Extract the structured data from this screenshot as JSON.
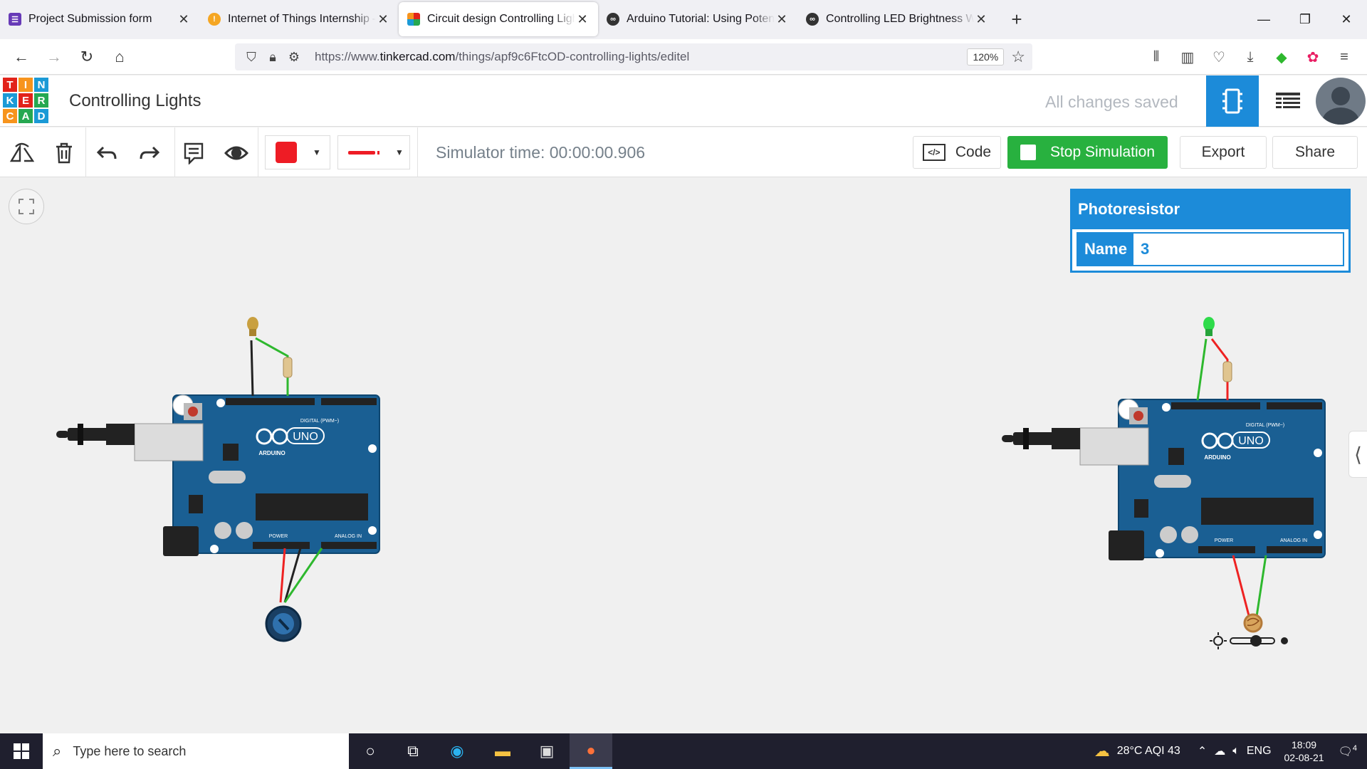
{
  "browser": {
    "tabs": [
      {
        "title": "Project Submission form",
        "fav_color": "#673ab7",
        "fav_glyph": "☰"
      },
      {
        "title": "Internet of Things Internship – ",
        "fav_color": "#f5a623",
        "fav_glyph": "!"
      },
      {
        "title": "Circuit design Controlling Lights",
        "fav_color": "#e53935",
        "fav_glyph": "▦"
      },
      {
        "title": "Arduino Tutorial: Using Potentio",
        "fav_color": "#333333",
        "fav_glyph": "∞"
      },
      {
        "title": "Controlling LED Brightness With",
        "fav_color": "#333333",
        "fav_glyph": "∞"
      }
    ],
    "url_prefix": "https://www.",
    "url_domain": "tinkercad.com",
    "url_path": "/things/apf9c6FtcOD-controlling-lights/editel",
    "zoom": "120%"
  },
  "app": {
    "logo_letters": [
      "T",
      "I",
      "N",
      "K",
      "E",
      "R",
      "C",
      "A",
      "D"
    ],
    "logo_colors": [
      "#e2231a",
      "#f7941d",
      "#1b9ad6",
      "#1b9ad6",
      "#e2231a",
      "#26a851",
      "#f7941d",
      "#26a851",
      "#1b9ad6"
    ],
    "title": "Controlling Lights",
    "save_status": "All changes saved"
  },
  "toolbar": {
    "sim_time": "Simulator time: 00:00:00.906",
    "code_label": "Code",
    "stop_label": "Stop Simulation",
    "export_label": "Export",
    "share_label": "Share",
    "color_value": "#ee1c25"
  },
  "inspector": {
    "component": "Photoresistor",
    "name_label": "Name",
    "name_value": "3"
  },
  "board": {
    "brand": "ARDUINO",
    "model": "UNO",
    "digital": "DIGITAL (PWM~)",
    "power": "POWER",
    "analog": "ANALOG IN"
  },
  "taskbar": {
    "search_placeholder": "Type here to search",
    "weather": "28°C  AQI 43",
    "lang": "ENG",
    "time": "18:09",
    "date": "02-08-21",
    "notifications": "4"
  }
}
